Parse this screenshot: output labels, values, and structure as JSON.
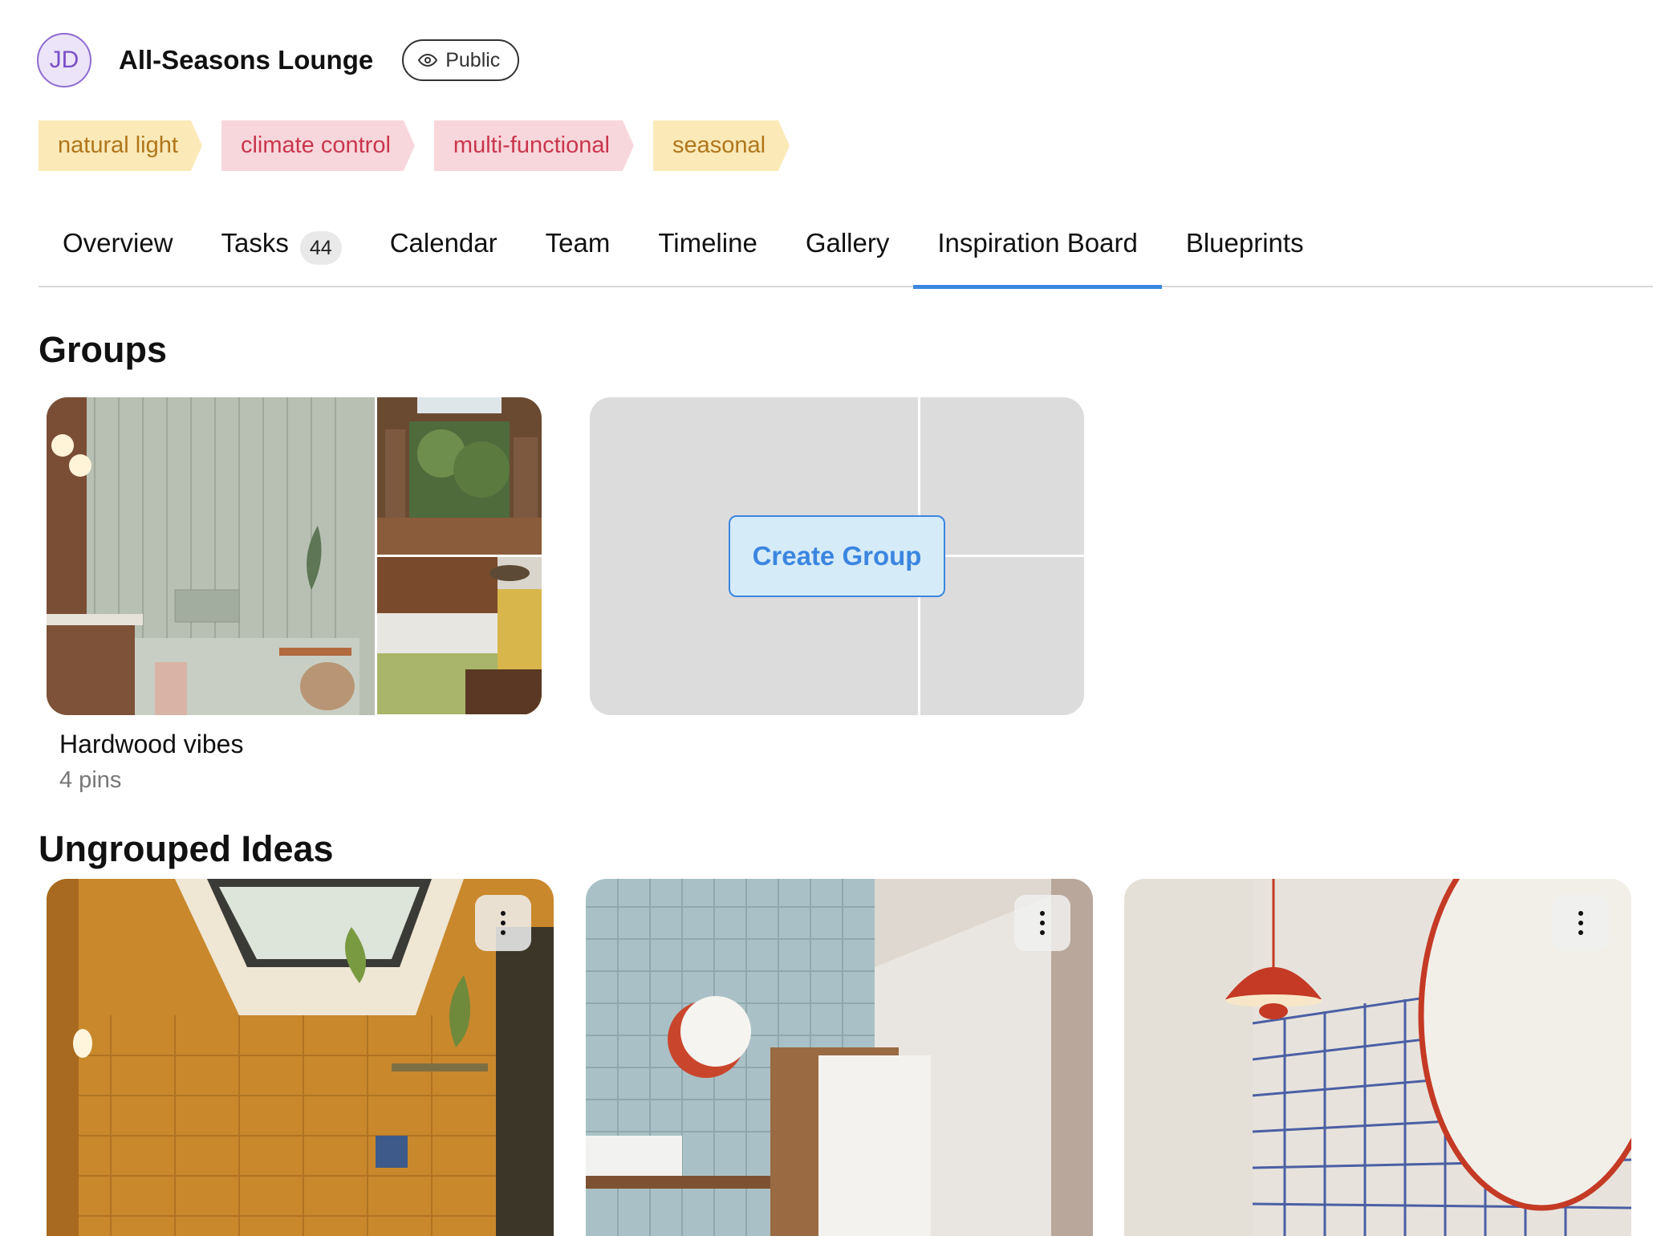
{
  "project": {
    "avatar_initials": "JD",
    "title": "All-Seasons Lounge",
    "visibility": "Public"
  },
  "tags": [
    {
      "label": "natural light",
      "color": "yellow"
    },
    {
      "label": "climate control",
      "color": "pink"
    },
    {
      "label": "multi-functional",
      "color": "pink"
    },
    {
      "label": "seasonal",
      "color": "yellow"
    }
  ],
  "tabs": {
    "overview": "Overview",
    "tasks": "Tasks",
    "tasks_count": "44",
    "calendar": "Calendar",
    "team": "Team",
    "timeline": "Timeline",
    "gallery": "Gallery",
    "inspiration": "Inspiration Board",
    "blueprints": "Blueprints",
    "active": "Inspiration Board"
  },
  "groups_section": {
    "title": "Groups",
    "group": {
      "name": "Hardwood vibes",
      "count": "4 pins"
    },
    "create_label": "Create Group"
  },
  "ungrouped_section": {
    "title": "Ungrouped Ideas"
  },
  "colors": {
    "accent": "#3b86e0",
    "tag_yellow_bg": "#fbe9b8",
    "tag_yellow_text": "#b0761b",
    "tag_pink_bg": "#f8d7dc",
    "tag_pink_text": "#c9364d"
  }
}
